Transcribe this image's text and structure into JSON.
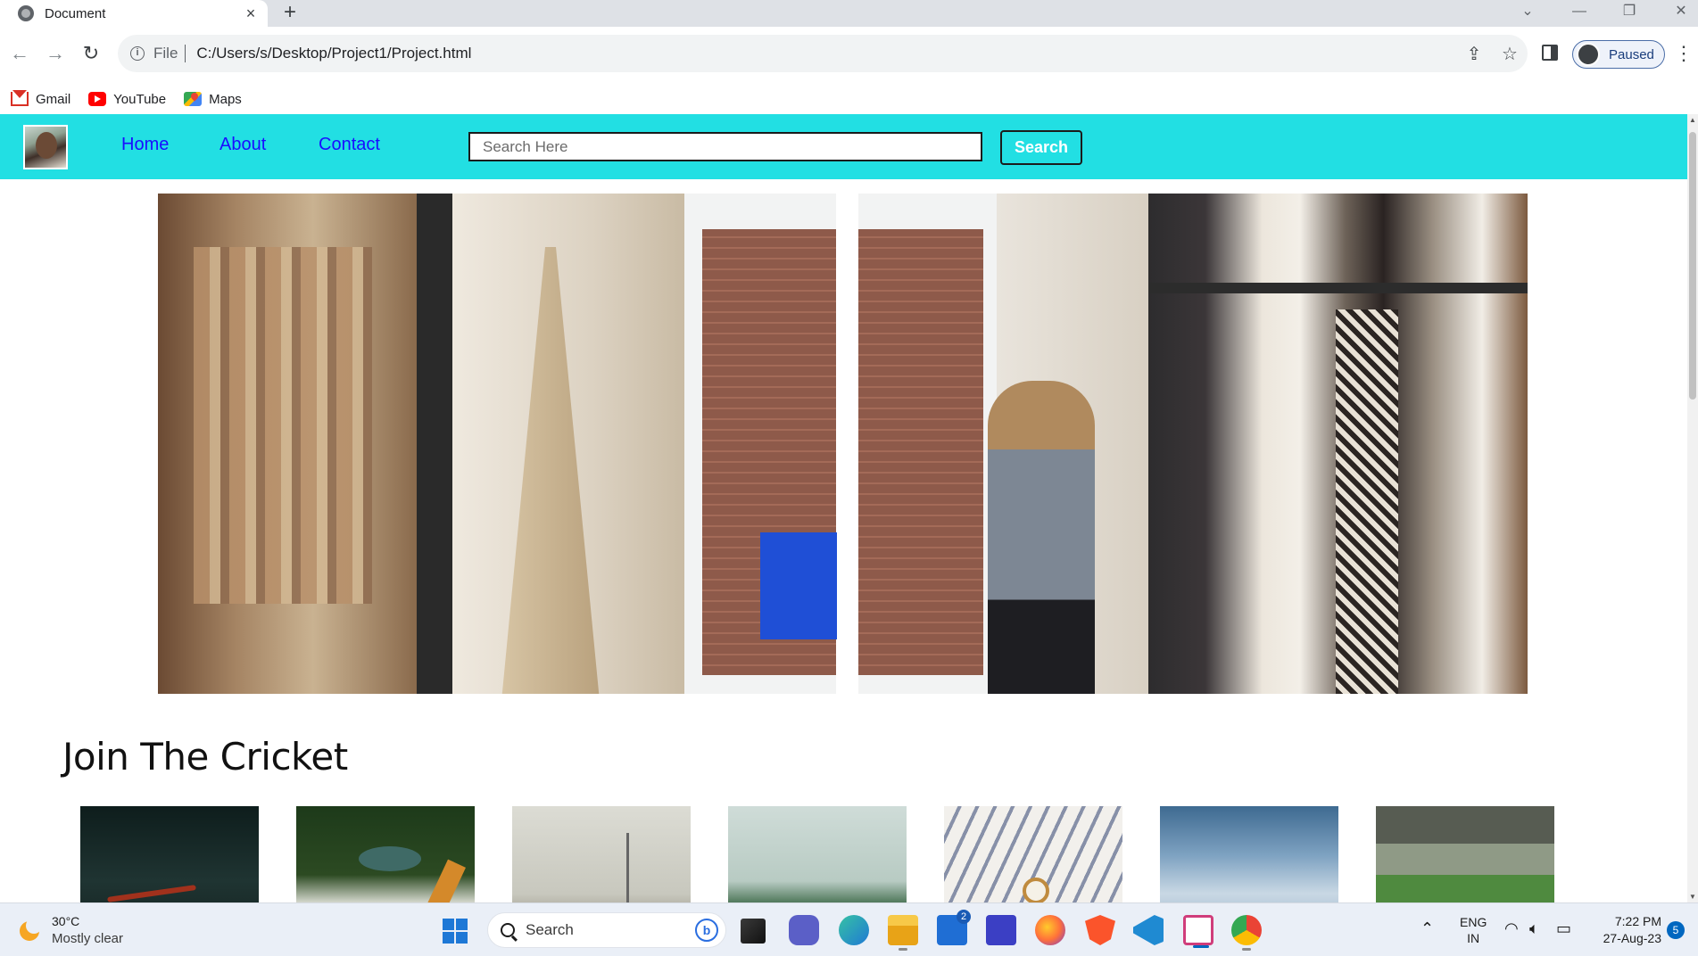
{
  "browser": {
    "tab_title": "Document",
    "tab_close_glyph": "×",
    "new_tab_glyph": "+",
    "address_scheme": "File",
    "address_url": "C:/Users/s/Desktop/Project1/Project.html",
    "profile_status": "Paused",
    "bookmarks": [
      {
        "label": "Gmail",
        "icon": "gmail-icon"
      },
      {
        "label": "YouTube",
        "icon": "youtube-icon"
      },
      {
        "label": "Maps",
        "icon": "maps-icon"
      }
    ]
  },
  "site": {
    "nav_links": [
      "Home",
      "About",
      "Contact"
    ],
    "search_placeholder": "Search Here",
    "search_button": "Search",
    "section_title": "Join The Cricket",
    "colors": {
      "nav_bg": "#22dfe3",
      "link": "#1a0dff"
    }
  },
  "taskbar": {
    "weather_temp": "30°C",
    "weather_condition": "Mostly clear",
    "search_label": "Search",
    "mail_badge": "2",
    "lang_line1": "ENG",
    "lang_line2": "IN",
    "time": "7:22 PM",
    "date": "27-Aug-23",
    "notification_count": "5"
  }
}
